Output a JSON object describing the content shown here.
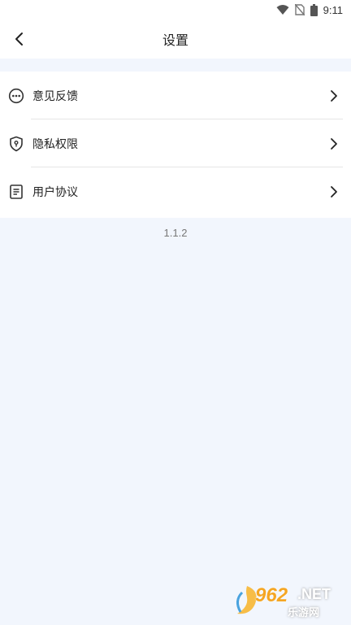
{
  "status_bar": {
    "time": "9:11",
    "icons": [
      "wifi-icon",
      "no-sim-icon",
      "battery-icon"
    ]
  },
  "app_bar": {
    "back_icon": "back-arrow-icon",
    "title": "设置"
  },
  "menu": {
    "items": [
      {
        "label": "意见反馈",
        "icon": "more-dots-icon"
      },
      {
        "label": "隐私权限",
        "icon": "shield-lock-icon"
      },
      {
        "label": "用户协议",
        "icon": "document-icon"
      }
    ]
  },
  "version": "1.1.2",
  "watermark": {
    "number": "962",
    "suffix": ".NET",
    "text": "乐游网"
  },
  "colors": {
    "background": "#f2f6fd",
    "surface": "#ffffff",
    "text": "#222222",
    "divider": "#e6e6e6"
  }
}
